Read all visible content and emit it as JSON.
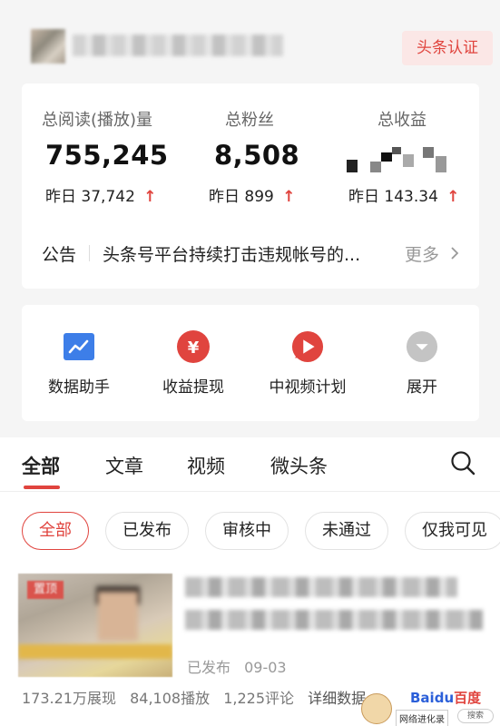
{
  "header": {
    "verify_label": "头条认证"
  },
  "stats": [
    {
      "label": "总阅读(播放)量",
      "value": "755,245",
      "yesterday_prefix": "昨日",
      "yesterday_value": "37,742"
    },
    {
      "label": "总粉丝",
      "value": "8,508",
      "yesterday_prefix": "昨日",
      "yesterday_value": "899"
    },
    {
      "label": "总收益",
      "value": "",
      "yesterday_prefix": "昨日",
      "yesterday_value": "143.34"
    }
  ],
  "up_arrow": "↑",
  "notice": {
    "label": "公告",
    "text": "头条号平台持续打击违规帐号的...",
    "more": "更多"
  },
  "tools": [
    {
      "label": "数据助手",
      "icon": "data-assistant-icon",
      "color": "#3d7ee8"
    },
    {
      "label": "收益提现",
      "icon": "yuan-icon",
      "color": "#e0443e"
    },
    {
      "label": "中视频计划",
      "icon": "play-icon",
      "color": "#e0443e"
    },
    {
      "label": "展开",
      "icon": "expand-icon",
      "color": "#bdbdbd"
    }
  ],
  "tabs": [
    {
      "label": "全部"
    },
    {
      "label": "文章"
    },
    {
      "label": "视频"
    },
    {
      "label": "微头条"
    }
  ],
  "filters": [
    {
      "label": "全部"
    },
    {
      "label": "已发布"
    },
    {
      "label": "审核中"
    },
    {
      "label": "未通过"
    },
    {
      "label": "仅我可见"
    }
  ],
  "article": {
    "thumb_tag": "置顶",
    "status": "已发布",
    "date": "09-03",
    "impressions": "173.21万展现",
    "plays": "84,108播放",
    "comments": "1,225评论",
    "detail": "详细数据"
  },
  "watermark": {
    "brand_a": "Bai",
    "brand_b": "du",
    "brand_c": "百度",
    "site": "网络进化录",
    "search": "搜索"
  },
  "colors": {
    "accent": "#e0443e",
    "blue": "#3d7ee8",
    "background": "#f5f5f5"
  }
}
